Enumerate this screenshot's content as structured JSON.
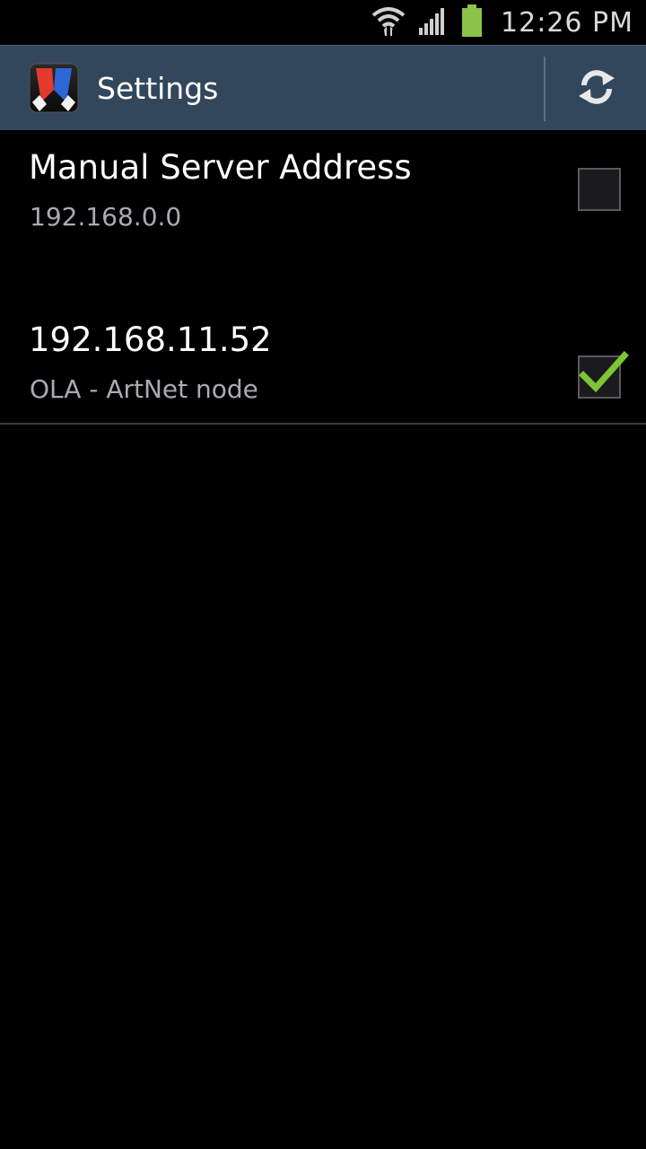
{
  "status_bar": {
    "time": "12:26 PM",
    "wifi_icon": "wifi-icon",
    "signal_icon": "signal-icon",
    "battery_icon": "battery-icon",
    "battery_color": "#8bc34a"
  },
  "action_bar": {
    "title": "Settings",
    "app_icon": "app-logo-icon",
    "refresh_icon": "refresh-icon",
    "background": "#32475c"
  },
  "list": {
    "items": [
      {
        "title": "Manual Server Address",
        "subtitle": "192.168.0.0",
        "checked": false
      },
      {
        "title": "192.168.11.52",
        "subtitle": "OLA - ArtNet node",
        "checked": true
      }
    ],
    "check_color": "#7cc633"
  }
}
